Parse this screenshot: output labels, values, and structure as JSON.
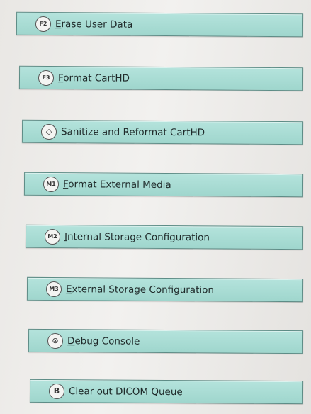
{
  "menu": {
    "items": [
      {
        "key": "F2",
        "label": "Erase User Data",
        "hotkey_char": "E"
      },
      {
        "key": "F3",
        "label": "Format CartHD",
        "hotkey_char": "F"
      },
      {
        "key": "◇",
        "label": "Sanitize and Reformat CartHD",
        "hotkey_char": ""
      },
      {
        "key": "M1",
        "label": "Format External Media",
        "hotkey_char": "F"
      },
      {
        "key": "M2",
        "label": "Internal Storage Configuration",
        "hotkey_char": "I"
      },
      {
        "key": "M3",
        "label": "External Storage Configuration",
        "hotkey_char": "E"
      },
      {
        "key": "⊗",
        "label": "Debug Console",
        "hotkey_char": "D"
      },
      {
        "key": "B",
        "label": "Clear out DICOM Queue",
        "hotkey_char": ""
      }
    ]
  },
  "colors": {
    "button_fill": "#a9dcd4",
    "button_border": "#5d8c86",
    "background": "#eeedeb"
  }
}
